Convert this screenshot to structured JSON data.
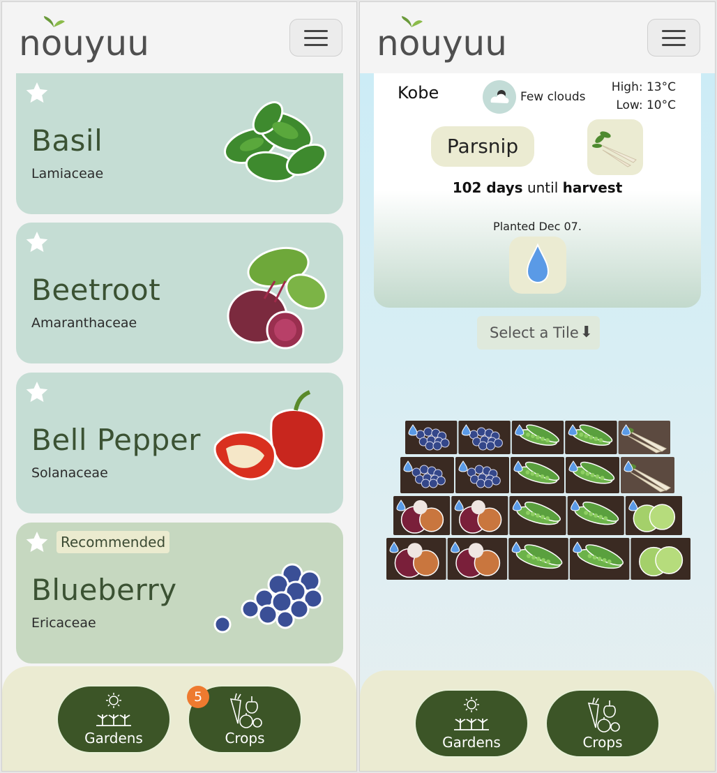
{
  "app": {
    "logo_text": "nouyuu"
  },
  "crops_screen": {
    "cards": [
      {
        "name": "Basil",
        "family": "Lamiaceae",
        "recommended": false
      },
      {
        "name": "Beetroot",
        "family": "Amaranthaceae",
        "recommended": false
      },
      {
        "name": "Bell Pepper",
        "family": "Solanaceae",
        "recommended": false
      },
      {
        "name": "Blueberry",
        "family": "Ericaceae",
        "recommended": true
      }
    ],
    "recommended_label": "Recommended",
    "nav": {
      "gardens_label": "Gardens",
      "crops_label": "Crops",
      "crops_badge": "5"
    }
  },
  "garden_screen": {
    "city": "Kobe",
    "weather": "Few clouds",
    "high": "High: 13°C",
    "low": "Low: 10°C",
    "crop": "Parsnip",
    "harvest_days": "102 days",
    "harvest_until": "until",
    "harvest_word": "harvest",
    "planted": "Planted Dec 07.",
    "select_tile": "Select a Tile",
    "nav": {
      "gardens_label": "Gardens",
      "crops_label": "Crops"
    },
    "tiles": [
      [
        "blueberry",
        "blueberry",
        "pea",
        "pea",
        "parsnip"
      ],
      [
        "blueberry",
        "blueberry",
        "pea",
        "pea",
        "parsnip"
      ],
      [
        "onion",
        "onion",
        "pea",
        "pea",
        "lettuce"
      ],
      [
        "onion",
        "onion",
        "pea",
        "pea",
        "lettuce"
      ]
    ],
    "watered": [
      [
        true,
        true,
        true,
        true,
        true
      ],
      [
        true,
        true,
        true,
        true,
        true
      ],
      [
        true,
        true,
        true,
        true,
        true
      ],
      [
        true,
        true,
        true,
        true,
        false
      ]
    ]
  },
  "colors": {
    "card": "#c5ddd4",
    "card_recommended": "#c6d8c0",
    "nav_button": "#3c5527",
    "bottom_bar": "#ebebd2",
    "badge": "#ee7a2f"
  },
  "icons": [
    "star-icon",
    "menu-icon",
    "sun-sprouts-icon",
    "vegetables-icon",
    "cloud-icon",
    "water-drop-icon",
    "arrow-down-icon"
  ]
}
